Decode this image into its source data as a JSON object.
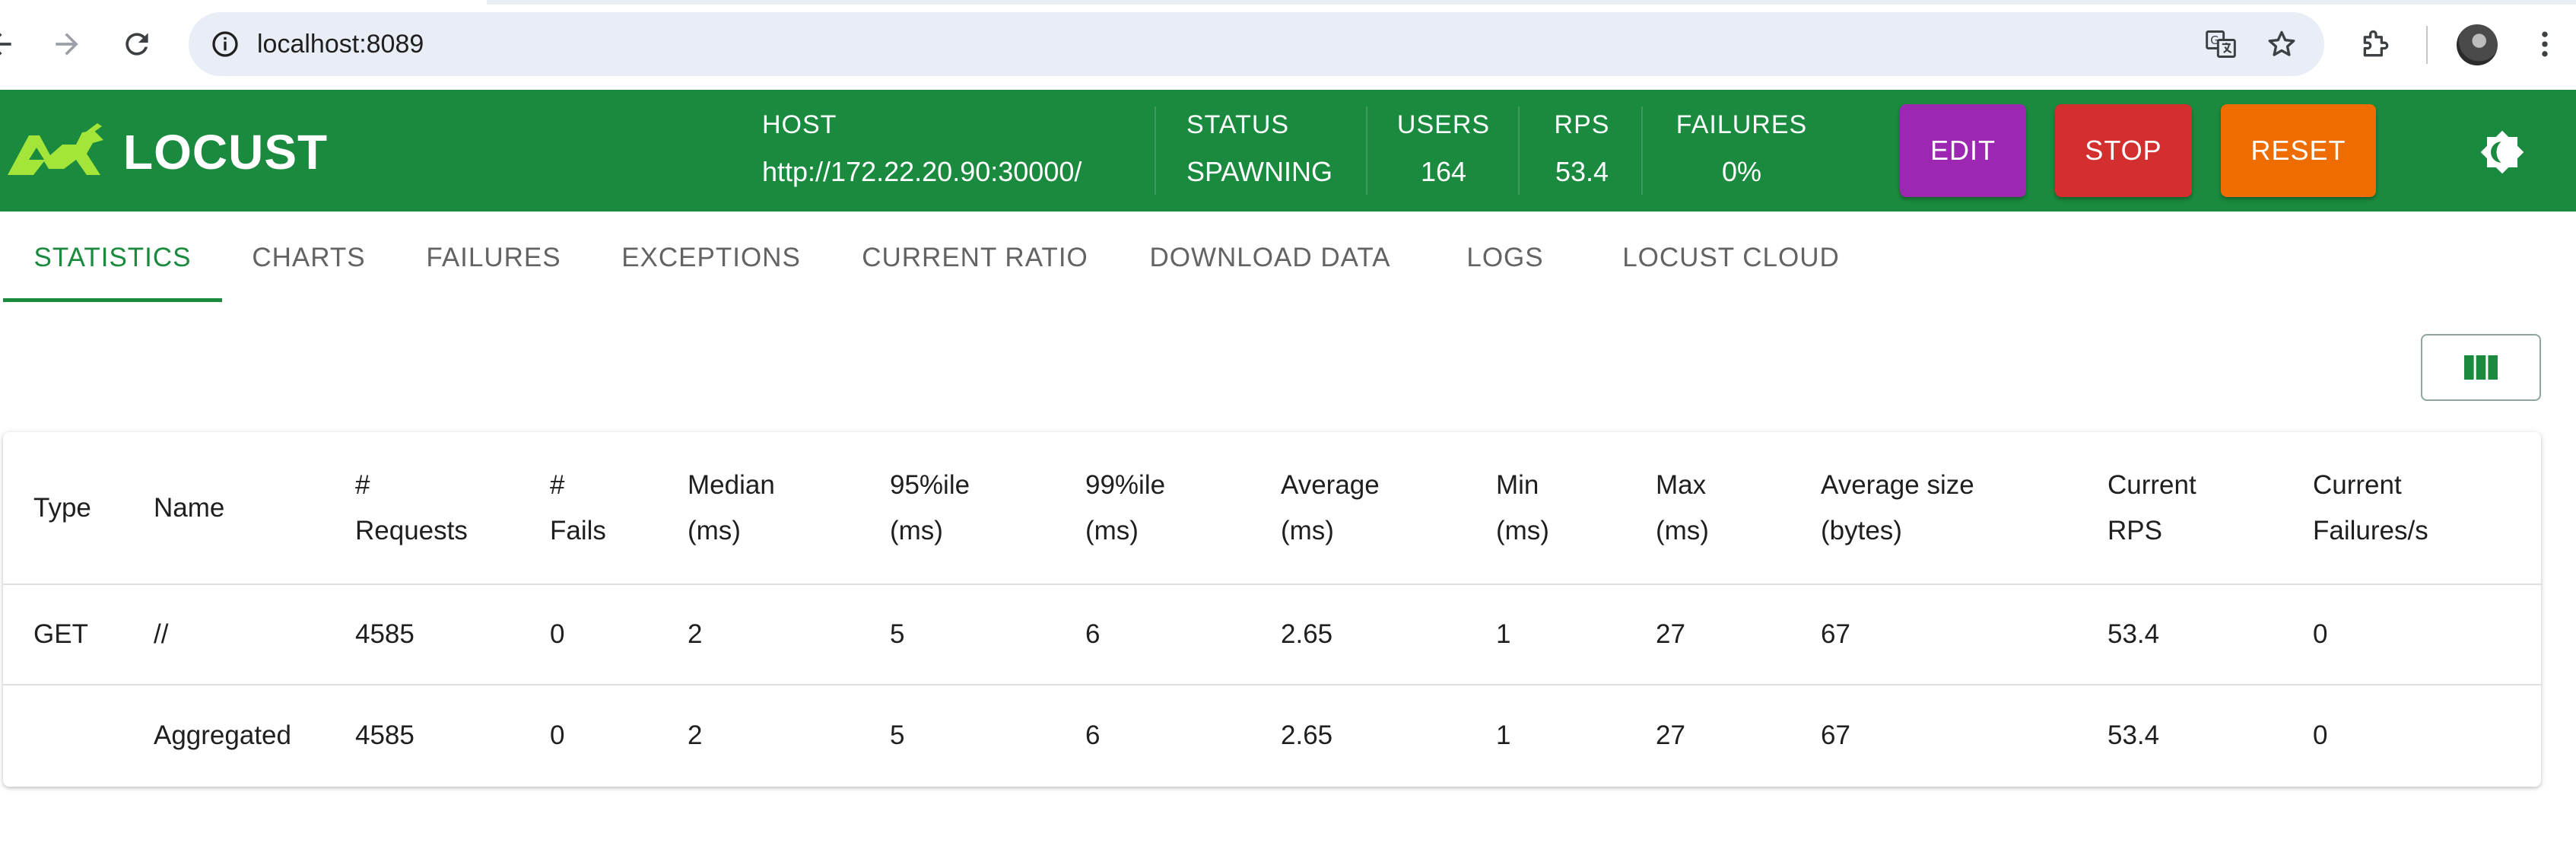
{
  "browser": {
    "url": "localhost:8089"
  },
  "app": {
    "logo_text": "LOCUST",
    "host_label": "HOST",
    "host_value": "http://172.22.20.90:30000/",
    "status_label": "STATUS",
    "status_value": "SPAWNING",
    "users_label": "USERS",
    "users_value": "164",
    "rps_label": "RPS",
    "rps_value": "53.4",
    "failures_label": "FAILURES",
    "failures_value": "0%",
    "edit_label": "EDIT",
    "stop_label": "STOP",
    "reset_label": "RESET",
    "colors": {
      "header": "#1a8a3e",
      "edit": "#9c27b0",
      "stop": "#d32f2f",
      "reset": "#ef6c00"
    }
  },
  "tabs": [
    {
      "label": "STATISTICS",
      "active": true
    },
    {
      "label": "CHARTS"
    },
    {
      "label": "FAILURES"
    },
    {
      "label": "EXCEPTIONS"
    },
    {
      "label": "CURRENT RATIO"
    },
    {
      "label": "DOWNLOAD DATA"
    },
    {
      "label": "LOGS"
    },
    {
      "label": "LOCUST CLOUD"
    }
  ],
  "table": {
    "headers": [
      [
        "Type"
      ],
      [
        "Name"
      ],
      [
        "#",
        "Requests"
      ],
      [
        "#",
        "Fails"
      ],
      [
        "Median",
        "(ms)"
      ],
      [
        "95%ile",
        "(ms)"
      ],
      [
        "99%ile",
        "(ms)"
      ],
      [
        "Average",
        "(ms)"
      ],
      [
        "Min",
        "(ms)"
      ],
      [
        "Max",
        "(ms)"
      ],
      [
        "Average size",
        "(bytes)"
      ],
      [
        "Current",
        "RPS"
      ],
      [
        "Current",
        "Failures/s"
      ]
    ],
    "rows": [
      [
        "GET",
        "//",
        "4585",
        "0",
        "2",
        "5",
        "6",
        "2.65",
        "1",
        "27",
        "67",
        "53.4",
        "0"
      ],
      [
        "",
        "Aggregated",
        "4585",
        "0",
        "2",
        "5",
        "6",
        "2.65",
        "1",
        "27",
        "67",
        "53.4",
        "0"
      ]
    ]
  }
}
